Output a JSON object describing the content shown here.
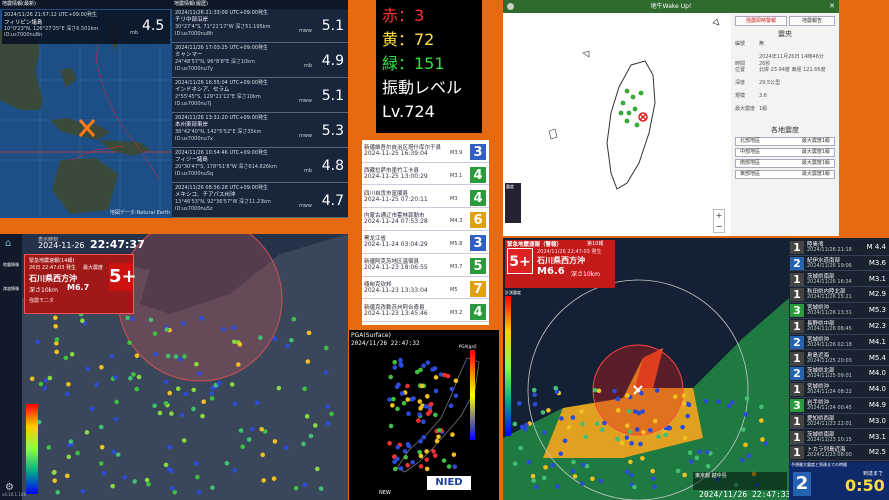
{
  "panel1": {
    "header_left": "地震情報(最新)",
    "header_right": "地震情報(履歴)",
    "latest": {
      "date": "2024/11/26 21:57:12 UTC+09:00発生",
      "place": "フィリピン諸島",
      "coords": "10°0'23\"N, 126°27'25\"E 深さ6.501km",
      "id": "ID:us7000nu8n",
      "mag_type": "mb",
      "mag": "4.5"
    },
    "history": [
      {
        "date": "2024/11/26 21:33:09 UTC+09:00発生",
        "place": "チリ中部沿岸",
        "coords": "30°27'4\"S, 71°21'17\"W 深さ51.195km",
        "id": "ID:us7000nu8h",
        "mag_type": "mww",
        "mag": "5.1"
      },
      {
        "date": "2024/11/26 17:03:25 UTC+09:00発生",
        "place": "ミャンマー",
        "coords": "24°48'57\"N, 96°8'8\"E 深さ10km",
        "id": "ID:us7000nu7y",
        "mag_type": "mb",
        "mag": "4.9"
      },
      {
        "date": "2024/11/26 16:55:04 UTC+09:00発生",
        "place": "インドネシア、セラム",
        "coords": "2°55'45\"S, 129°21'12\"E 深さ10km",
        "id": "ID:us7000nu7j",
        "mag_type": "mww",
        "mag": "5.1"
      },
      {
        "date": "2024/11/26 13:31:20 UTC+09:00発生",
        "place": "本州東部東岸",
        "coords": "38°42'40\"N, 142°5'52\"E 深さ35km",
        "id": "ID:us7000nu7x",
        "mag_type": "mww",
        "mag": "5.3"
      },
      {
        "date": "2024/11/26 10:54:46 UTC+09:00発生",
        "place": "フィジー諸島",
        "coords": "20°30'47\"S, 178°51'8\"W 深さ614.826km",
        "id": "ID:us7000nu5q",
        "mag_type": "mb",
        "mag": "4.8"
      },
      {
        "date": "2024/11/26 08:56:28 UTC+09:00発生",
        "place": "メキシコ、チアパス州沖",
        "coords": "13°46'53\"N, 92°36'57\"W 深さ11.23km",
        "id": "ID:us7000nu5z",
        "mag_type": "mww",
        "mag": "4.7"
      }
    ],
    "credit": "地図データ:Natural Earth"
  },
  "counts": {
    "red": "赤：3",
    "yellow": "黄：72",
    "green": "緑：151",
    "level_label": "振動レベル",
    "level": "Lv.724"
  },
  "cn_list": [
    {
      "name": "新疆維吾尔自治区塔什库尔干县",
      "date": "2024-11-25 16:39:04",
      "mag": "M3.9",
      "depth": "114km",
      "int": "3",
      "color": "#2f5fc4"
    },
    {
      "name": "西藏拉萨市墨竹工卡县",
      "date": "2024-11-25 13:00:29",
      "mag": "M3.1",
      "depth": "",
      "int": "4",
      "color": "#2b9a3a"
    },
    {
      "name": "四川自贡市富顺县",
      "date": "2024-11-25 07:20:11",
      "mag": "M3",
      "depth": "",
      "int": "4",
      "color": "#2b9a3a"
    },
    {
      "name": "内蒙古通辽市霍林郭勒市",
      "date": "2024-11-24 07:53:28",
      "mag": "M4.3",
      "depth": "",
      "int": "6",
      "color": "#e0a010"
    },
    {
      "name": "黑龙江省",
      "date": "2024-11-24 03:04:29",
      "mag": "M5.8",
      "depth": "",
      "int": "3",
      "color": "#2f5fc4"
    },
    {
      "name": "新疆阿克苏地区温宿县",
      "date": "2024-11-23 18:06:55",
      "mag": "M3.7",
      "depth": "",
      "int": "5",
      "color": "#2b9a3a"
    },
    {
      "name": "缅甸克钦邦",
      "date": "2024-11-23 13:33:04",
      "mag": "M5",
      "depth": "",
      "int": "7",
      "color": "#e0a010"
    },
    {
      "name": "新疆克孜勒苏州阿合奇县",
      "date": "2024-11-23 13:45:46",
      "mag": "M3.2",
      "depth": "",
      "int": "4",
      "color": "#2b9a3a"
    }
  ],
  "taiwan": {
    "title": "地牛Wake Up!",
    "tab1": "強震即時警報",
    "tab2": "地震報告",
    "section": "震央",
    "rows": [
      [
        "編號",
        "無"
      ],
      [
        "時間",
        "2024年11月26日 14時46分26秒"
      ],
      [
        "位置",
        "北緯 23.94度 東經 121.66度"
      ],
      [
        "深度",
        "29.5公里"
      ],
      [
        "規模",
        "3.6"
      ],
      [
        "最大震度",
        "1級"
      ]
    ],
    "obs_title": "各地震度",
    "obs": [
      [
        "北部地區",
        "最大震度1級"
      ],
      [
        "中部地區",
        "最大震度1級"
      ],
      [
        "南部地區",
        "最大震度1級"
      ],
      [
        "東部地區",
        "最大震度1級"
      ]
    ],
    "legend": [
      "震度",
      "1",
      "2",
      "3",
      "4",
      "5弱",
      "5強",
      "6弱",
      "6強",
      "7"
    ]
  },
  "kanto": {
    "time_label": "表示時刻",
    "time": "2024-11-26",
    "clock": "22:47:37",
    "alert": "緊急地震速報(14報)",
    "alert_date": "26日 22:47:03 発生",
    "max_label": "最大震度",
    "region": "石川県西方沖",
    "depth": "深さ10km",
    "mag": "M6.7",
    "int": "5+",
    "note": "強震モニタ",
    "left_labels": [
      "地震情報",
      "津波情報"
    ],
    "version": "v4.10.1.106"
  },
  "wave": {
    "title": "PGA(Surface)",
    "time": "2024/11/26 22:47:32",
    "unit": "PGA[gal]",
    "logo": "NIED",
    "new": "NEW"
  },
  "alert7": {
    "header": "緊急地震速報（警報）",
    "report": "第10報",
    "int_label": "予想最大震度",
    "int": "5+",
    "time": "2024/11/26 22:47:03 発生",
    "region": "石川県西方沖",
    "mag": "M6.6",
    "depth": "深さ10km",
    "scale_label": "計測震度",
    "footer": "2024/11/26 22:47:33",
    "seconds_label": "到達まで",
    "seconds": "0:50",
    "footer_note": "予想最大震度と到達までの時間",
    "footer_region": "東京都 越中島",
    "footer_int": "2",
    "list": [
      {
        "int": "1",
        "area": "陸奥湾",
        "date": "2024/11/26 21:18",
        "mag": "M 4.4",
        "depth": "深さ120km",
        "color": "#444"
      },
      {
        "int": "2",
        "area": "紀伊水道南部",
        "date": "2024/11/26 19:06",
        "mag": "M3.6",
        "color": "#2563b0"
      },
      {
        "int": "1",
        "area": "茨城県南部",
        "date": "2024/11/26 16:34",
        "mag": "M3.1",
        "color": "#444"
      },
      {
        "int": "1",
        "area": "秋田県内陸北部",
        "date": "2024/11/26 15:21",
        "mag": "M2.9",
        "color": "#444"
      },
      {
        "int": "3",
        "area": "宮城県沖",
        "date": "2024/11/26 13:31",
        "mag": "M5.3",
        "color": "#2b9a3a"
      },
      {
        "int": "1",
        "area": "長野県中部",
        "date": "2024/11/26 08:45",
        "mag": "M2.3",
        "color": "#444"
      },
      {
        "int": "2",
        "area": "宮城県沖",
        "date": "2024/11/26 02:18",
        "mag": "M4.1",
        "color": "#2563b0"
      },
      {
        "int": "1",
        "area": "鳥島近海",
        "date": "2024/11/25 20:03",
        "mag": "M5.4",
        "color": "#444"
      },
      {
        "int": "2",
        "area": "茨城県北部",
        "date": "2024/11/25 09:01",
        "mag": "M4.0",
        "color": "#2563b0"
      },
      {
        "int": "1",
        "area": "宮城県沖",
        "date": "2024/11/24 08:22",
        "mag": "M4.0",
        "color": "#444"
      },
      {
        "int": "3",
        "area": "岩手県沖",
        "date": "2024/11/24 00:45",
        "mag": "M4.9",
        "color": "#2b9a3a"
      },
      {
        "int": "1",
        "area": "愛知県西部",
        "date": "2024/11/23 22:01",
        "mag": "M3.0",
        "color": "#444"
      },
      {
        "int": "1",
        "area": "茨城県南部",
        "date": "2024/11/23 10:15",
        "mag": "M3.1",
        "color": "#444"
      },
      {
        "int": "1",
        "area": "トカラ列島近海",
        "date": "2024/11/23 08:00",
        "mag": "M2.5",
        "color": "#444"
      }
    ]
  }
}
